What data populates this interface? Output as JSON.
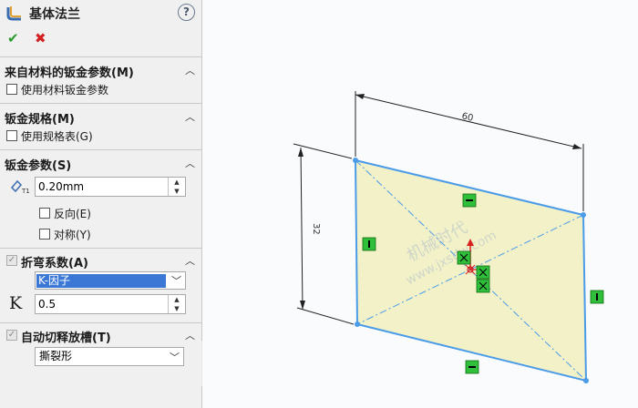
{
  "panel": {
    "title": "基体法兰",
    "help_icon": "?",
    "ok_icon": "✔",
    "cancel_icon": "✖",
    "sections": {
      "material": {
        "title": "来自材料的钣金参数(M)",
        "checkbox_label": "使用材料钣金参数",
        "checked": false
      },
      "gauge": {
        "title": "钣金规格(M)",
        "checkbox_label": "使用规格表(G)",
        "checked": false
      },
      "params": {
        "title": "钣金参数(S)",
        "thickness_value": "0.20mm",
        "reverse_label": "反向(E)",
        "symmetric_label": "对称(Y)"
      },
      "bend": {
        "title": "折弯系数(A)",
        "type_value": "K-因子",
        "k_symbol": "K",
        "k_value": "0.5"
      },
      "relief": {
        "title": "自动切释放槽(T)",
        "type_value": "撕裂形"
      }
    }
  },
  "viewport": {
    "dim_horizontal": "60",
    "dim_vertical": "32",
    "watermark_line1": "机械时代",
    "watermark_line2": "www.jxsdw.com",
    "colors": {
      "edge": "#4a9be8",
      "fill": "#f3f1c8",
      "relation": "#2fbf3a"
    }
  }
}
